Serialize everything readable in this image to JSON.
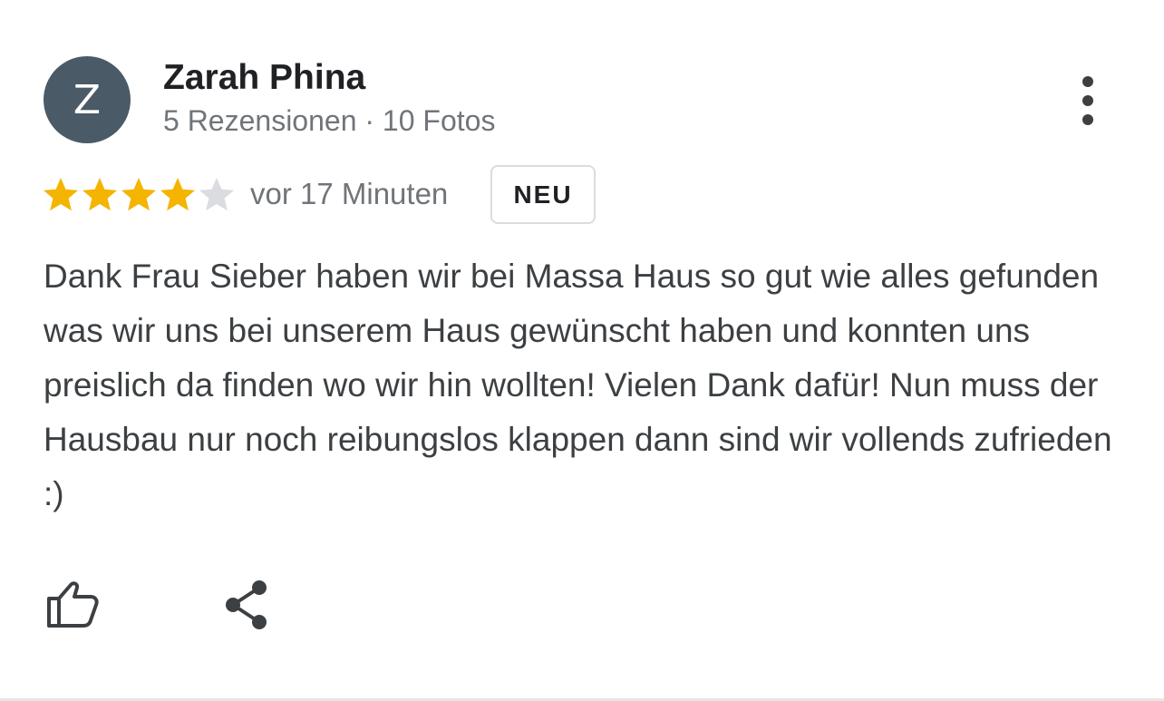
{
  "review": {
    "avatar_letter": "Z",
    "author_name": "Zarah Phina",
    "author_meta": "5 Rezensionen · 10 Fotos",
    "rating": 4,
    "rating_max": 5,
    "time_ago": "vor 17 Minuten",
    "badge": "NEU",
    "text": "Dank Frau Sieber haben wir bei Massa Haus so gut wie alles gefunden was wir uns bei unserem Haus gewünscht haben und konnten uns preislich da finden wo wir hin wollten! Vielen Dank dafür! Nun muss der Hausbau nur noch reibungslos klappen dann sind wir vollends zufrieden :)"
  },
  "icons": {
    "more": "more-vertical-icon",
    "like": "thumbs-up-icon",
    "share": "share-icon",
    "star": "star-icon"
  },
  "colors": {
    "avatar_bg": "#4a5a66",
    "star_filled": "#f4b400",
    "star_empty": "#dadce0",
    "secondary_text": "#70757a",
    "body_text": "#3c4043"
  }
}
